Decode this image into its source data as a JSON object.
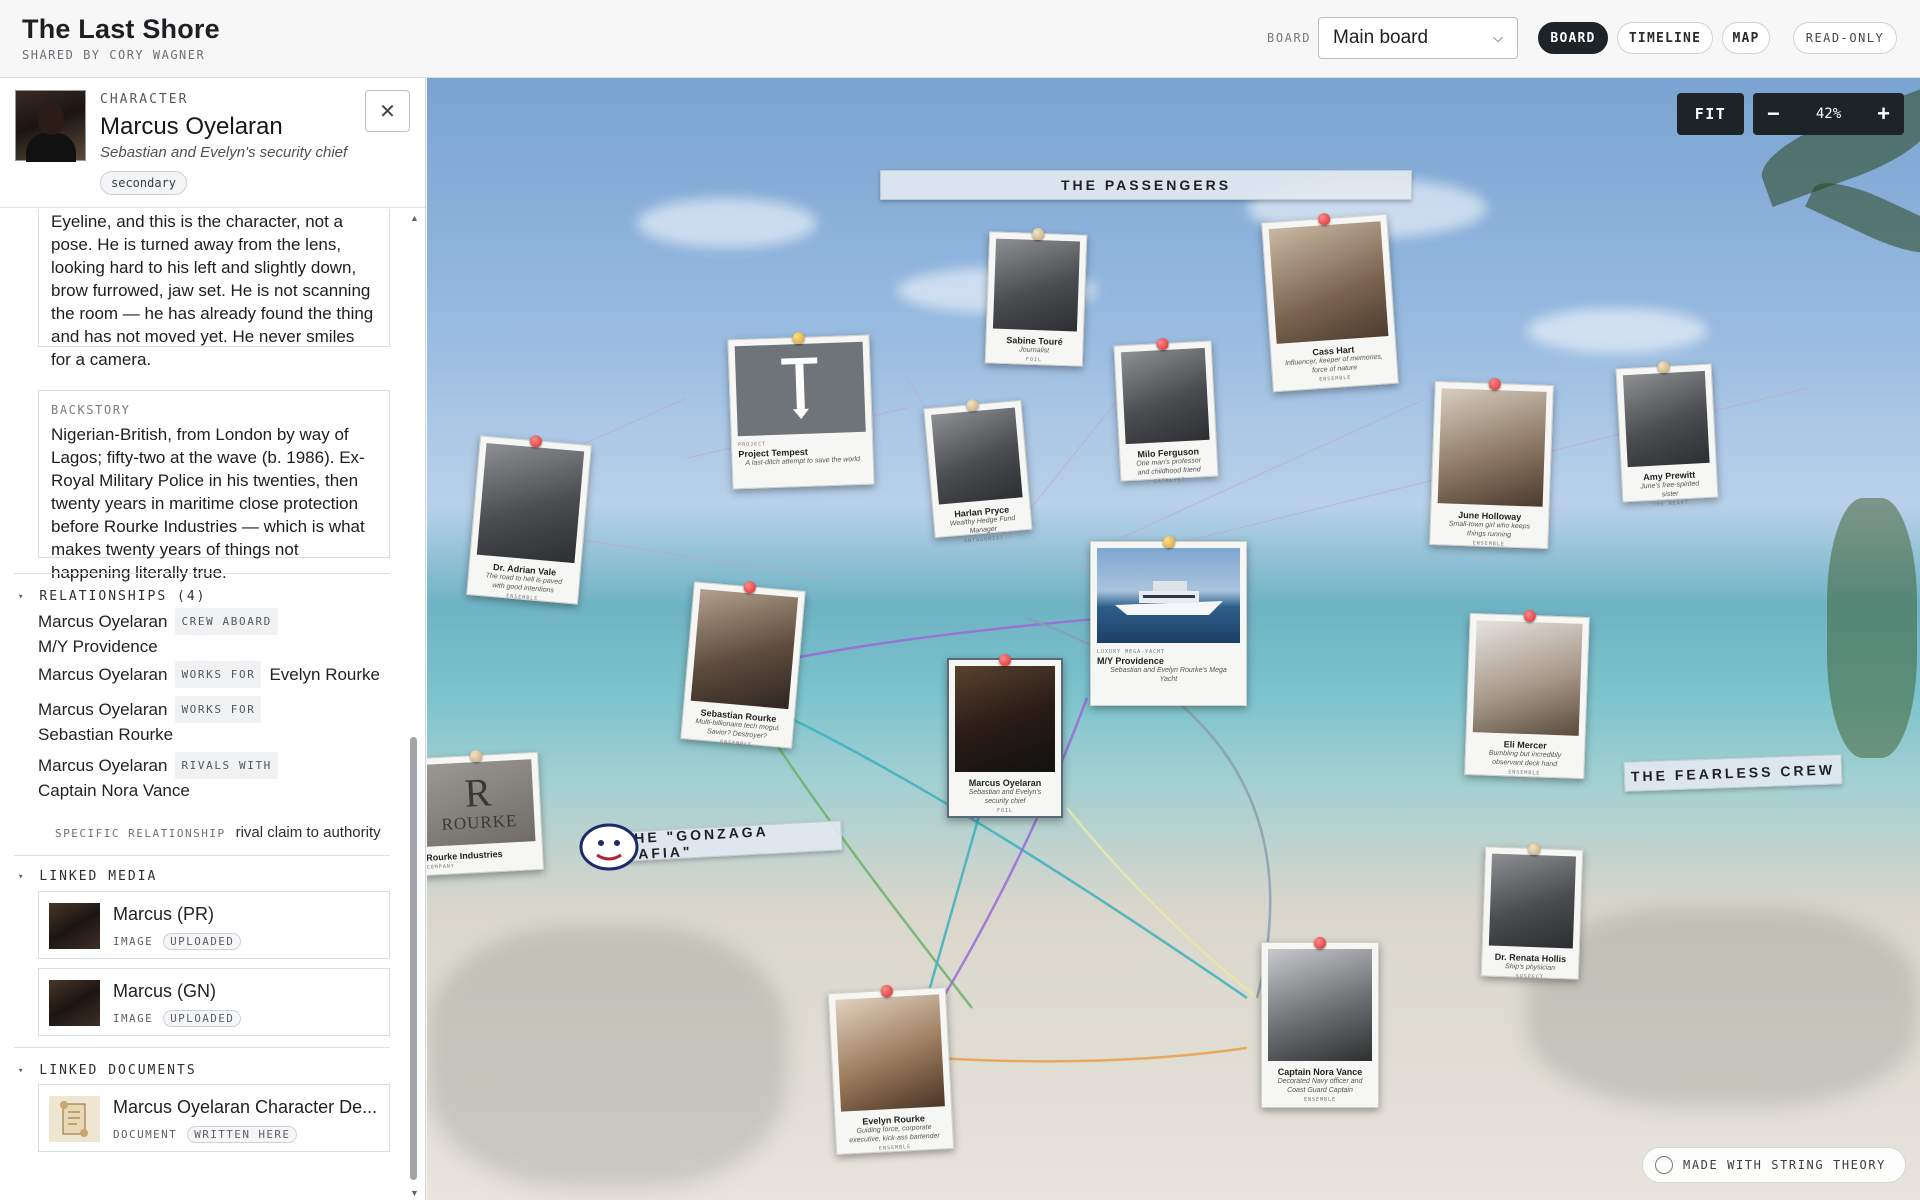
{
  "header": {
    "title": "The Last Shore",
    "shared_by": "SHARED BY CORY WAGNER",
    "board_label": "BOARD",
    "board_select": "Main board",
    "tabs": [
      "BOARD",
      "TIMELINE",
      "MAP"
    ],
    "active_tab": "BOARD",
    "read_only": "READ-ONLY"
  },
  "panel": {
    "kind": "CHARACTER",
    "name": "Marcus Oyelaran",
    "role": "Sebastian and Evelyn's security chief",
    "tag": "secondary",
    "eyeline_text": "Eyeline, and this is the character, not a pose. He is turned away from the lens, looking hard to his left and slightly down, brow furrowed, jaw set. He is not scanning the room — he has already found the thing and has not moved yet. He never smiles for a camera.",
    "backstory_label": "BACKSTORY",
    "backstory_text": "Nigerian-British, from London by way of Lagos; fifty-two at the wave (b. 1986). Ex-Royal Military Police in his twenties, then twenty years in maritime close protection before Rourke Industries — which is what makes twenty years of things not happening literally true.",
    "relationships_title": "RELATIONSHIPS (4)",
    "relationships": [
      {
        "subject": "Marcus Oyelaran",
        "type": "CREW ABOARD",
        "target": "M/Y Providence"
      },
      {
        "subject": "Marcus Oyelaran",
        "type": "WORKS FOR",
        "target": "Evelyn Rourke"
      },
      {
        "subject": "Marcus Oyelaran",
        "type": "WORKS FOR",
        "target": "Sebastian Rourke"
      },
      {
        "subject": "Marcus Oyelaran",
        "type": "RIVALS WITH",
        "target": "Captain Nora Vance"
      }
    ],
    "specific_label": "SPECIFIC RELATIONSHIP",
    "specific_value": "rival claim to authority",
    "linked_media_title": "LINKED MEDIA",
    "linked_media": [
      {
        "title": "Marcus (PR)",
        "kind": "IMAGE",
        "status": "UPLOADED"
      },
      {
        "title": "Marcus (GN)",
        "kind": "IMAGE",
        "status": "UPLOADED"
      }
    ],
    "linked_docs_title": "LINKED DOCUMENTS",
    "linked_docs": [
      {
        "title": "Marcus Oyelaran Character De...",
        "kind": "DOCUMENT",
        "status": "WRITTEN HERE"
      }
    ]
  },
  "board": {
    "fit": "FIT",
    "zoom_out": "−",
    "zoom_level": "42%",
    "zoom_in": "+",
    "banners": {
      "passengers": "THE PASSENGERS",
      "crew": "THE FEARLESS CREW",
      "mafia": "THE \"GONZAGA MAFIA\""
    },
    "cards": {
      "sabine": {
        "name": "Sabine Touré",
        "desc": "Journalist",
        "type": "FOIL"
      },
      "cass": {
        "name": "Cass Hart",
        "desc": "Influencer, keeper of memories, force of nature",
        "type": "ENSEMBLE"
      },
      "tempest": {
        "name": "Project Tempest",
        "desc": "A last-ditch attempt to save the world",
        "type": "PROJECT"
      },
      "harlan": {
        "name": "Harlan Pryce",
        "desc": "Wealthy Hedge Fund Manager",
        "type": "ANTAGONIST"
      },
      "milo": {
        "name": "Milo Ferguson",
        "desc": "One man's professor and childhood friend",
        "type": "CATALYST"
      },
      "june": {
        "name": "June Holloway",
        "desc": "Small-town girl who keeps things running",
        "type": "ENSEMBLE"
      },
      "amy": {
        "name": "Amy Prewitt",
        "desc": "June's free-spirited sister",
        "type": "THE HEART"
      },
      "adrian": {
        "name": "Dr. Adrian Vale",
        "desc": "The road to hell is paved with good intentions",
        "type": "ENSEMBLE"
      },
      "sebastian": {
        "name": "Sebastian Rourke",
        "desc": "Multi-billionaire tech mogul. Savior? Destroyer?",
        "type": "ENSEMBLE"
      },
      "providence": {
        "name": "M/Y Providence",
        "desc": "Sebastian and Evelyn Rourke's Mega Yacht",
        "type": "LUXURY MEGA-YACHT"
      },
      "marcus": {
        "name": "Marcus Oyelaran",
        "desc": "Sebastian and Evelyn's security chief",
        "type": "FOIL"
      },
      "eli": {
        "name": "Eli Mercer",
        "desc": "Bumbling but incredibly observant deck hand",
        "type": "ENSEMBLE"
      },
      "rourke": {
        "name": "Rourke Industries",
        "desc": "",
        "type": "COMPANY"
      },
      "renata": {
        "name": "Dr. Renata Hollis",
        "desc": "Ship's physician",
        "type": "SUSPECT"
      },
      "evelyn": {
        "name": "Evelyn Rourke",
        "desc": "Guiding force, corporate executive, kick-ass bartender",
        "type": "ENSEMBLE"
      },
      "nora": {
        "name": "Captain Nora Vance",
        "desc": "Decorated Navy officer and Coast Guard Captain",
        "type": "ENSEMBLE"
      }
    },
    "made_with": "MADE WITH STRING THEORY"
  }
}
